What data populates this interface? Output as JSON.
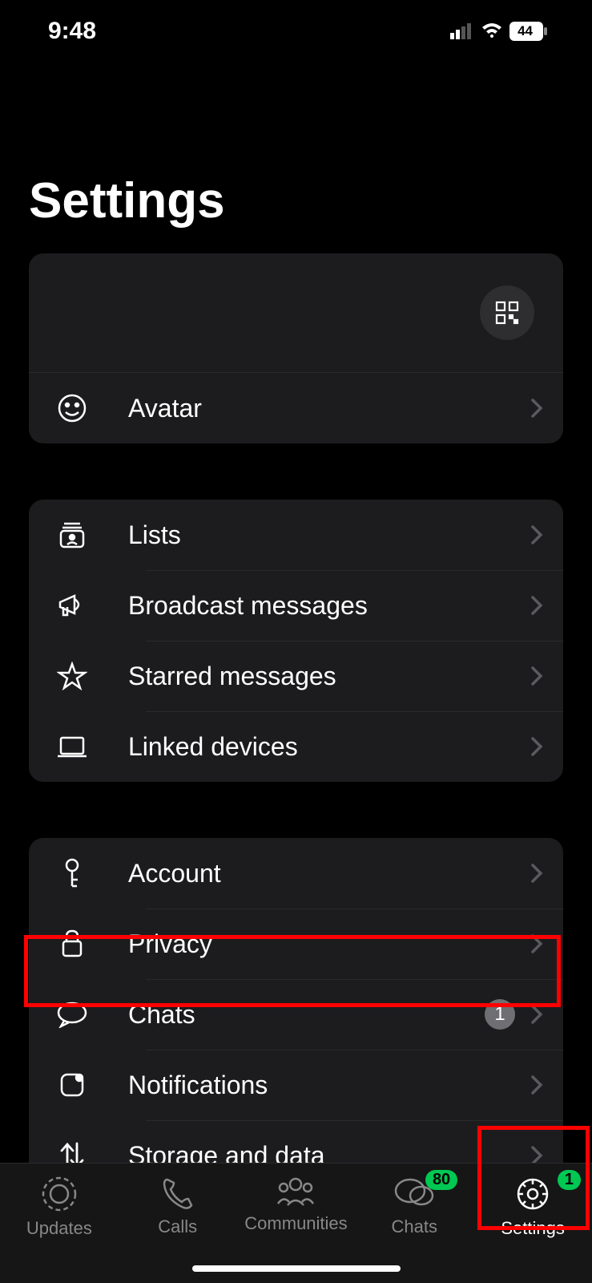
{
  "statusBar": {
    "time": "9:48",
    "battery": "44"
  },
  "title": "Settings",
  "profileSection": {
    "avatar": {
      "label": "Avatar"
    }
  },
  "group1": {
    "lists": {
      "label": "Lists"
    },
    "broadcast": {
      "label": "Broadcast messages"
    },
    "starred": {
      "label": "Starred messages"
    },
    "linked": {
      "label": "Linked devices"
    }
  },
  "group2": {
    "account": {
      "label": "Account"
    },
    "privacy": {
      "label": "Privacy"
    },
    "chats": {
      "label": "Chats",
      "badge": "1"
    },
    "notifications": {
      "label": "Notifications"
    },
    "storage": {
      "label": "Storage and data"
    }
  },
  "tabs": {
    "updates": {
      "label": "Updates"
    },
    "calls": {
      "label": "Calls"
    },
    "communities": {
      "label": "Communities"
    },
    "chats": {
      "label": "Chats",
      "badge": "80"
    },
    "settings": {
      "label": "Settings",
      "badge": "1"
    }
  }
}
